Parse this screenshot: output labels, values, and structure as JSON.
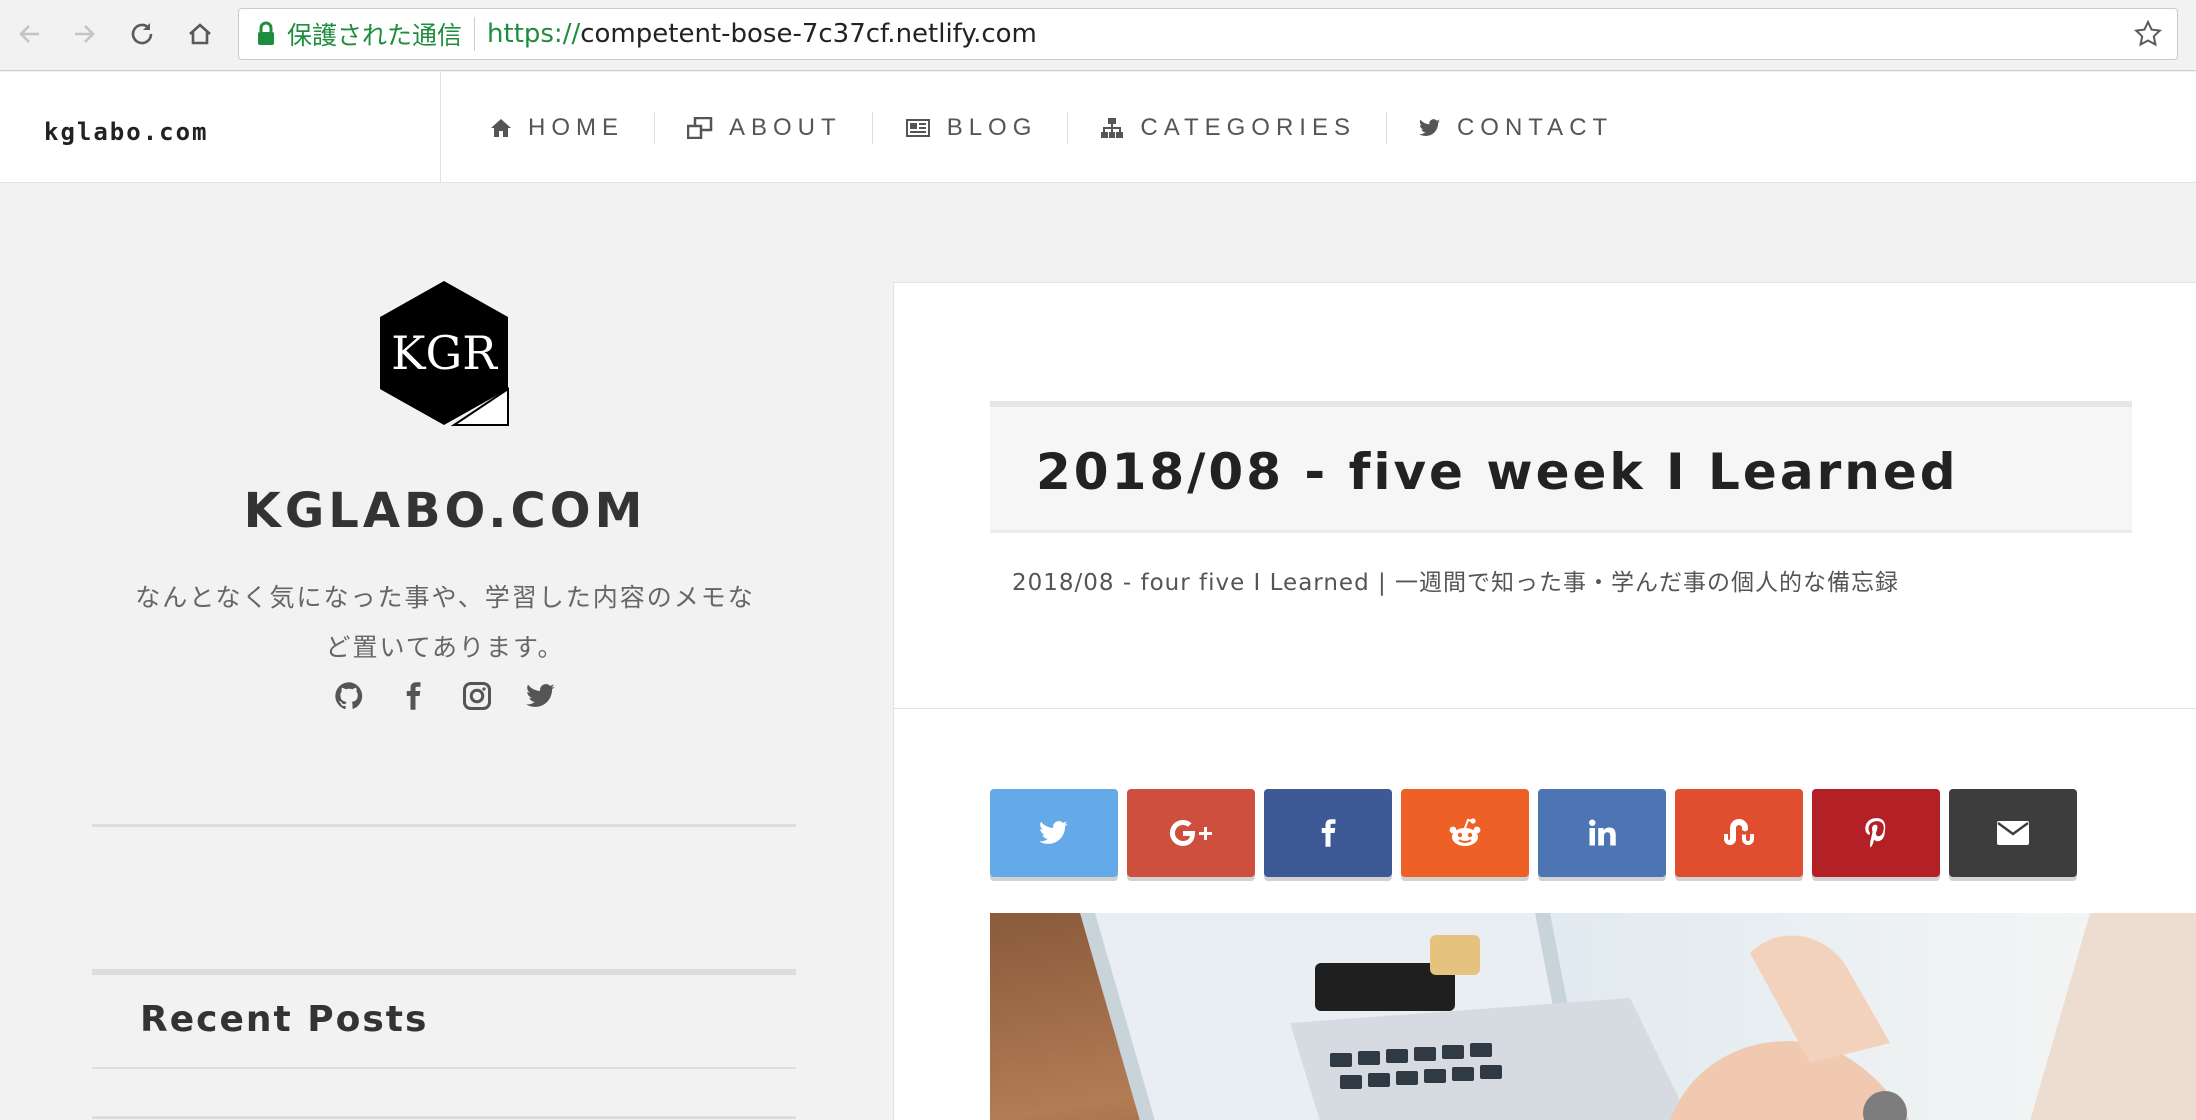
{
  "browser": {
    "secure_label": "保護された通信",
    "url_scheme": "https://",
    "url_host": "competent-bose-7c37cf.netlify.com"
  },
  "header": {
    "brand": "kglabo.com",
    "menu": [
      {
        "label": "HOME",
        "icon": "home-icon"
      },
      {
        "label": "ABOUT",
        "icon": "windows-icon"
      },
      {
        "label": "BLOG",
        "icon": "newspaper-icon"
      },
      {
        "label": "CATEGORIES",
        "icon": "sitemap-icon"
      },
      {
        "label": "CONTACT",
        "icon": "twitter-icon"
      }
    ]
  },
  "sidebar": {
    "logo_text": "KGR",
    "site_title": "KGLABO.COM",
    "tagline_line1": "なんとなく気になった事や、学習した内容のメモな",
    "tagline_line2": "ど置いてあります。",
    "social": [
      "github-icon",
      "facebook-icon",
      "instagram-icon",
      "twitter-icon"
    ],
    "recent_posts_title": "Recent Posts"
  },
  "post": {
    "title": "2018/08 - five week I Learned",
    "description": "2018/08 - four five I Learned | 一週間で知った事・学んだ事の個人的な備忘録"
  },
  "share_buttons": [
    {
      "name": "twitter",
      "color": "#64a9e8"
    },
    {
      "name": "google-plus",
      "color": "#cf4f3f"
    },
    {
      "name": "facebook",
      "color": "#3d5a96"
    },
    {
      "name": "reddit",
      "color": "#ee6026"
    },
    {
      "name": "linkedin",
      "color": "#4d74b3"
    },
    {
      "name": "stumbleupon",
      "color": "#e04d2f"
    },
    {
      "name": "pinterest",
      "color": "#b32127"
    },
    {
      "name": "email",
      "color": "#3d3d3d"
    }
  ]
}
